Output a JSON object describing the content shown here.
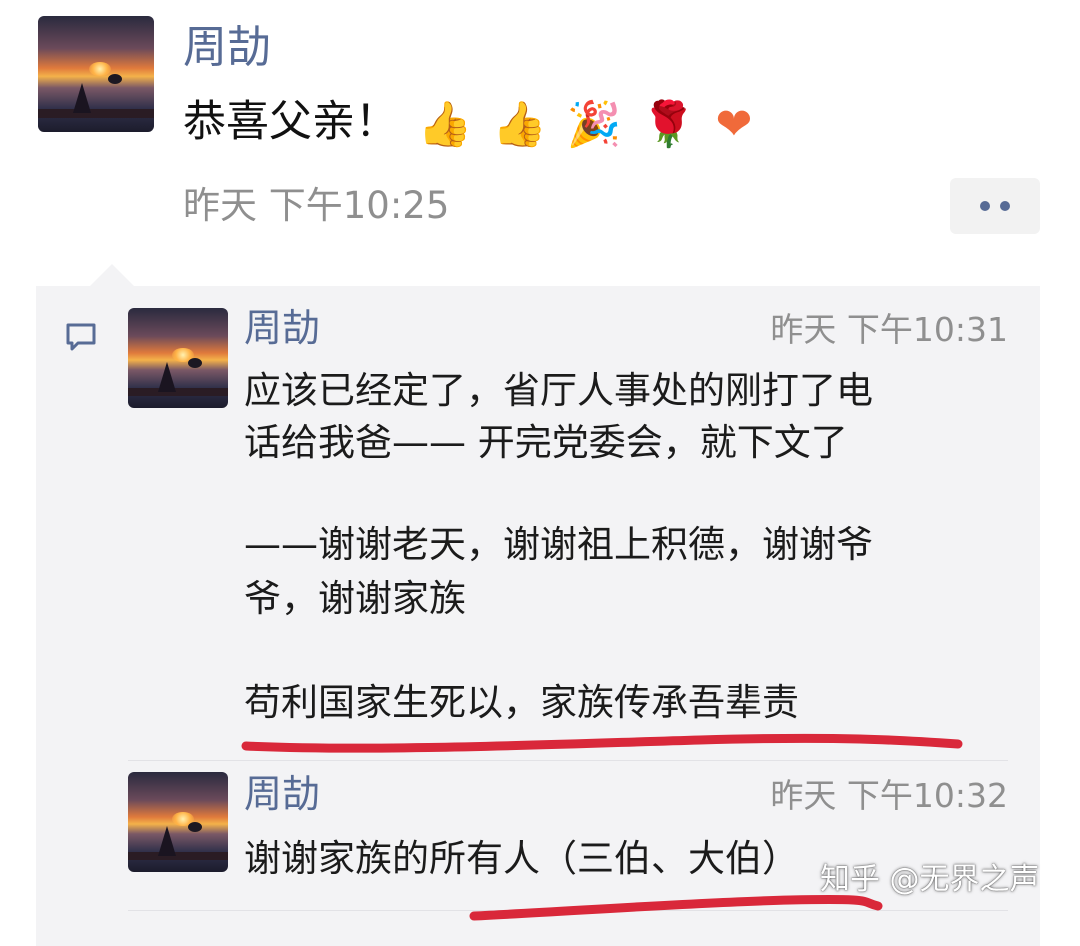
{
  "post": {
    "author": "周劼",
    "text": "恭喜父亲！",
    "emojis": [
      "👍",
      "👍",
      "🎉",
      "🌹",
      "❤"
    ],
    "time": "昨天 下午10:25",
    "more_icon": "more-dots-icon"
  },
  "comments": [
    {
      "author": "周劼",
      "time": "昨天 下午10:31",
      "lines": [
        "应该已经定了，省厅人事处的刚打了电",
        "话给我爸—— 开完党委会，就下文了",
        "——谢谢老天，谢谢祖上积德，谢谢爷",
        "爷，谢谢家族",
        "苟利国家生死以，家族传承吾辈责"
      ]
    },
    {
      "author": "周劼",
      "time": "昨天 下午10:32",
      "lines": [
        "谢谢家族的所有人（三伯、大伯）"
      ]
    }
  ],
  "watermark": "知乎 @无界之声",
  "colors": {
    "link": "#576b95",
    "time": "#8f8f8f",
    "underline": "#d9283a",
    "comment_bg": "#f3f3f5"
  }
}
